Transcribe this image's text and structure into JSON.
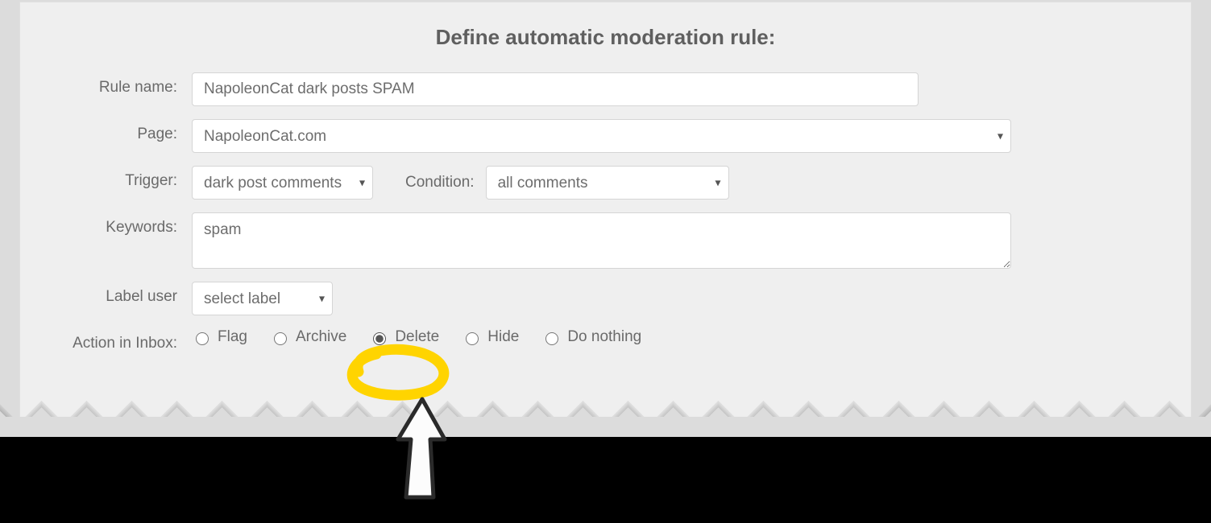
{
  "title": "Define automatic moderation rule:",
  "labels": {
    "rule_name": "Rule name:",
    "page": "Page:",
    "trigger": "Trigger:",
    "condition": "Condition:",
    "keywords": "Keywords:",
    "label_user": "Label user",
    "action_in_inbox": "Action in Inbox:"
  },
  "values": {
    "rule_name": "NapoleonCat dark posts SPAM",
    "page": "NapoleonCat.com",
    "trigger": "dark post comments",
    "condition": "all comments",
    "keywords": "spam",
    "label_user": "select label"
  },
  "actions": {
    "selected": "Delete",
    "options": {
      "flag": "Flag",
      "archive": "Archive",
      "delete": "Delete",
      "hide": "Hide",
      "do_nothing": "Do nothing"
    }
  },
  "annotations": {
    "highlight_target": "delete-radio",
    "highlight_color": "#ffd400"
  }
}
